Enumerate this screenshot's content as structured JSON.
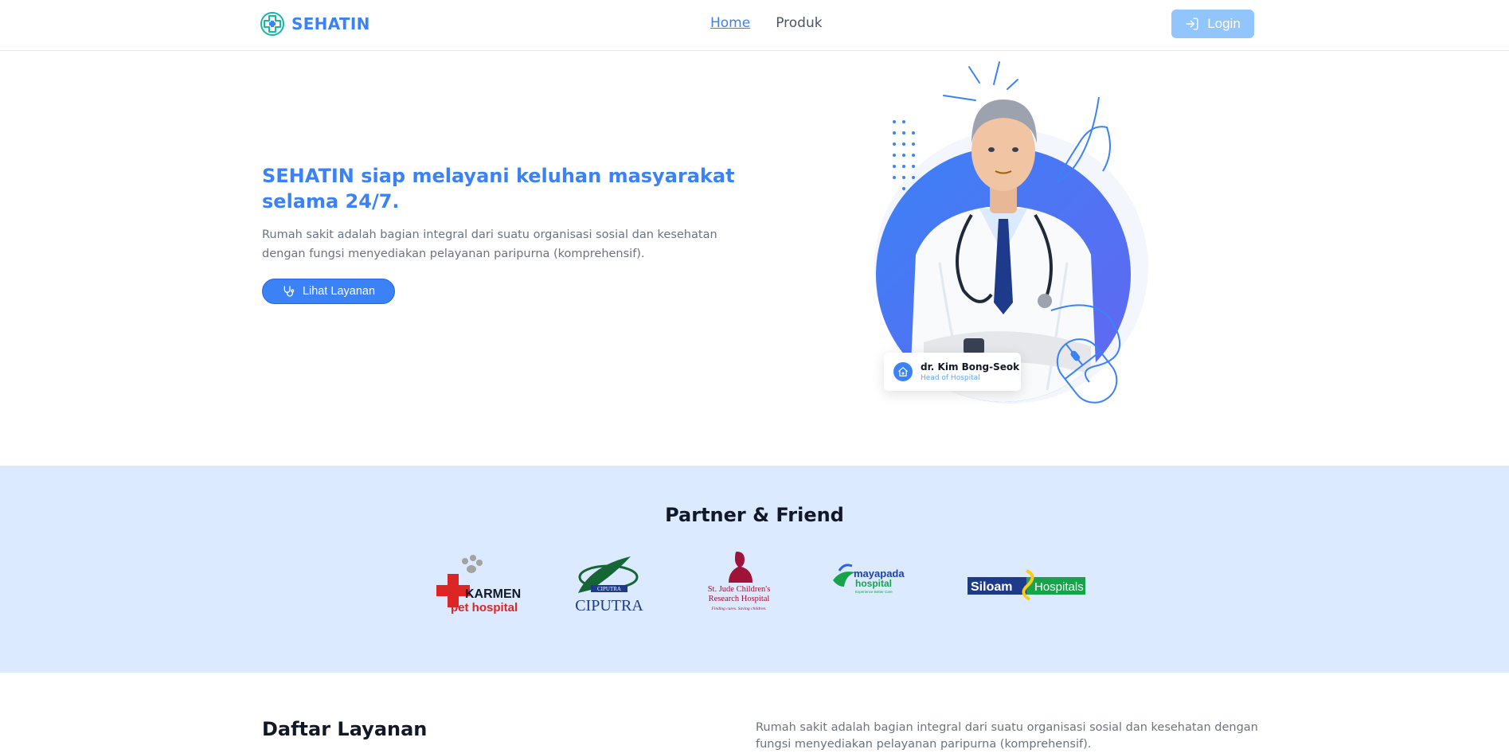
{
  "navbar": {
    "brand": "SEHATIN",
    "links": [
      {
        "label": "Home",
        "active": true
      },
      {
        "label": "Produk",
        "active": false
      }
    ],
    "login_label": "Login"
  },
  "hero": {
    "title": "SEHATIN siap melayani keluhan masyarakat selama 24/7.",
    "description": "Rumah sakit adalah bagian integral dari suatu organisasi sosial dan kesehatan dengan fungsi menyediakan pelayanan paripurna (komprehensif).",
    "button_label": "Lihat Layanan",
    "doctor": {
      "name": "dr. Kim Bong-Seok",
      "role": "Head of Hospital"
    }
  },
  "partners": {
    "title": "Partner & Friend",
    "logos": [
      {
        "name": "karmen-pet-hospital",
        "lines": [
          "KARMEN",
          "pet hospital"
        ]
      },
      {
        "name": "ciputra",
        "lines": [
          "CIPUTRA",
          "CIPUTRA"
        ]
      },
      {
        "name": "st-jude",
        "lines": [
          "St. Jude Children's",
          "Research Hospital",
          "Finding cures. Saving children."
        ]
      },
      {
        "name": "mayapada",
        "lines": [
          "mayapada",
          "hospital",
          "Experience Better Care"
        ]
      },
      {
        "name": "siloam",
        "lines": [
          "Siloam",
          "Hospitals"
        ]
      }
    ]
  },
  "services": {
    "title": "Daftar Layanan",
    "description": "Rumah sakit adalah bagian integral dari suatu organisasi sosial dan kesehatan dengan fungsi menyediakan pelayanan paripurna (komprehensif)."
  },
  "colors": {
    "primary": "#3b82f6",
    "login_bg": "#93c5fd",
    "partners_bg": "#dbeafe",
    "brand_accent": "#14b8a6"
  }
}
